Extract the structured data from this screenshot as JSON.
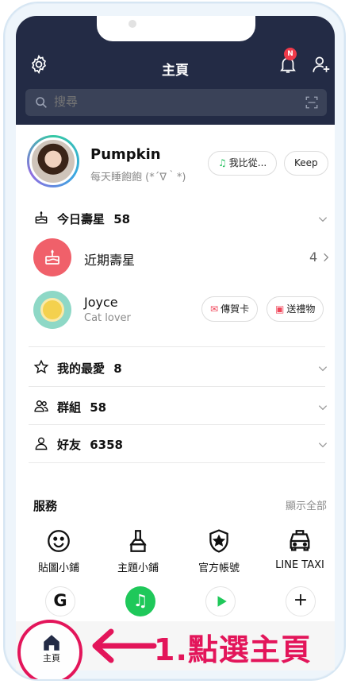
{
  "header": {
    "title": "主頁",
    "notification_count": "N"
  },
  "search": {
    "placeholder": "搜尋"
  },
  "profile": {
    "name": "Pumpkin",
    "status": "每天睡飽飽 (*´∇｀*)",
    "music_button": "我比從...",
    "keep_button": "Keep"
  },
  "birthdays_today": {
    "label": "今日壽星",
    "count": "58"
  },
  "recent_birthdays": {
    "label": "近期壽星",
    "count": "4"
  },
  "friend": {
    "name": "Joyce",
    "status": "Cat lover",
    "card_button": "傳賀卡",
    "gift_button": "送禮物"
  },
  "sections": [
    {
      "label": "我的最愛",
      "count": "8"
    },
    {
      "label": "群組",
      "count": "58"
    },
    {
      "label": "好友",
      "count": "6358"
    }
  ],
  "services": {
    "title": "服務",
    "show_all": "顯示全部",
    "items": [
      {
        "label": "貼圖小鋪",
        "icon": "smiley-icon"
      },
      {
        "label": "主題小鋪",
        "icon": "paintbrush-icon"
      },
      {
        "label": "官方帳號",
        "icon": "shield-star-icon"
      },
      {
        "label": "LINE TAXI",
        "icon": "taxi-icon"
      }
    ]
  },
  "bottom_nav": {
    "home_label": "主頁"
  },
  "annotation": {
    "text": "1.點選主頁"
  },
  "colors": {
    "header": "#232b45",
    "accent": "#e3155a",
    "green": "#1fbf5b"
  }
}
